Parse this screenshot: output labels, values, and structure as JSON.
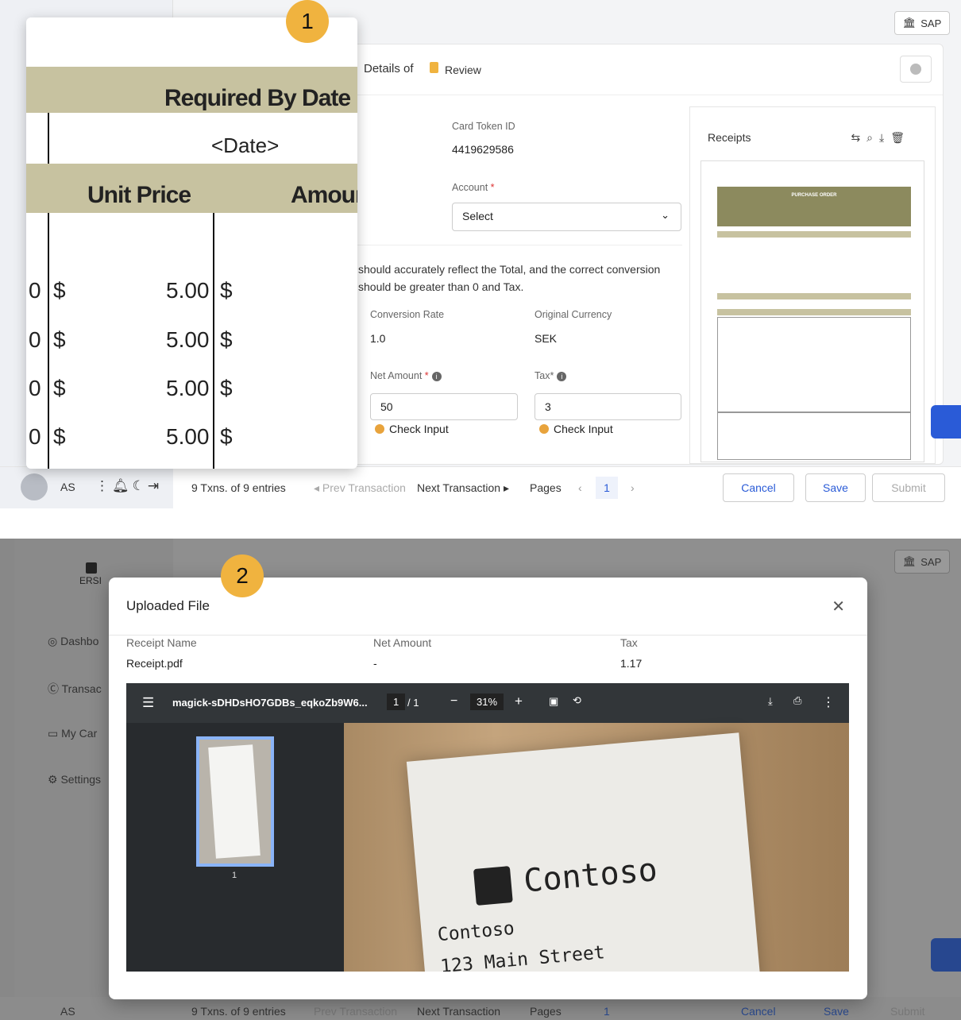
{
  "screen1": {
    "badge": "1",
    "sap_label": "SAP",
    "details_text": "Details of",
    "review_label": "Review",
    "card_token_label": "Card Token ID",
    "card_token_value": "4419629586",
    "account_label": "Account",
    "account_select": "Select",
    "note_line1": "should accurately reflect the Total, and the correct conversion",
    "note_line2": "should be greater than 0 and Tax.",
    "conversion_rate_label": "Conversion Rate",
    "conversion_rate_value": "1.0",
    "original_currency_label": "Original Currency",
    "original_currency_value": "SEK",
    "net_amount_label": "Net Amount",
    "net_amount_value": "50",
    "tax_label": "Tax*",
    "tax_value": "3",
    "check_input": "Check Input",
    "receipts_title": "Receipts",
    "po_title": "PURCHASE ORDER",
    "zoom": {
      "required_by_date": "Required By Date",
      "date_placeholder": "<Date>",
      "unit_price": "Unit Price",
      "amount": "Amoun",
      "rows": [
        {
          "qty": "0",
          "cur": "$",
          "price": "5.00",
          "cur2": "$"
        },
        {
          "qty": "0",
          "cur": "$",
          "price": "5.00",
          "cur2": "$"
        },
        {
          "qty": "0",
          "cur": "$",
          "price": "5.00",
          "cur2": "$"
        },
        {
          "qty": "0",
          "cur": "$",
          "price": "5.00",
          "cur2": "$"
        }
      ]
    },
    "footer": {
      "user": "AS",
      "txns": "9 Txns. of 9 entries",
      "prev": "Prev Transaction",
      "next": "Next Transaction",
      "pages": "Pages",
      "page_num": "1",
      "cancel": "Cancel",
      "save": "Save",
      "submit": "Submit"
    }
  },
  "screen2": {
    "badge": "2",
    "sap_label": "SAP",
    "logo_text": "ERSI",
    "nav": [
      "Dashbo",
      "Transac",
      "My Car",
      "Settings"
    ],
    "modal_title": "Uploaded File",
    "col_receipt_name": "Receipt Name",
    "col_net_amount": "Net Amount",
    "col_tax": "Tax",
    "receipt_name": "Receipt.pdf",
    "net_amount": "-",
    "tax": "1.17",
    "pdf_filename": "magick-sDHDsHO7GDBs_eqkoZb9W6...",
    "pdf_page_current": "1",
    "pdf_page_total": "/ 1",
    "pdf_zoom": "31%",
    "thumb_page": "1",
    "receipt_brand": "Contoso",
    "receipt_line1": "Contoso",
    "receipt_line2": "123 Main Street",
    "footer": {
      "user": "AS",
      "txns": "9 Txns. of 9 entries",
      "prev": "Prev Transaction",
      "next": "Next Transaction",
      "pages": "Pages",
      "page_num": "1",
      "cancel": "Cancel",
      "save": "Save",
      "submit": "Submit"
    }
  }
}
